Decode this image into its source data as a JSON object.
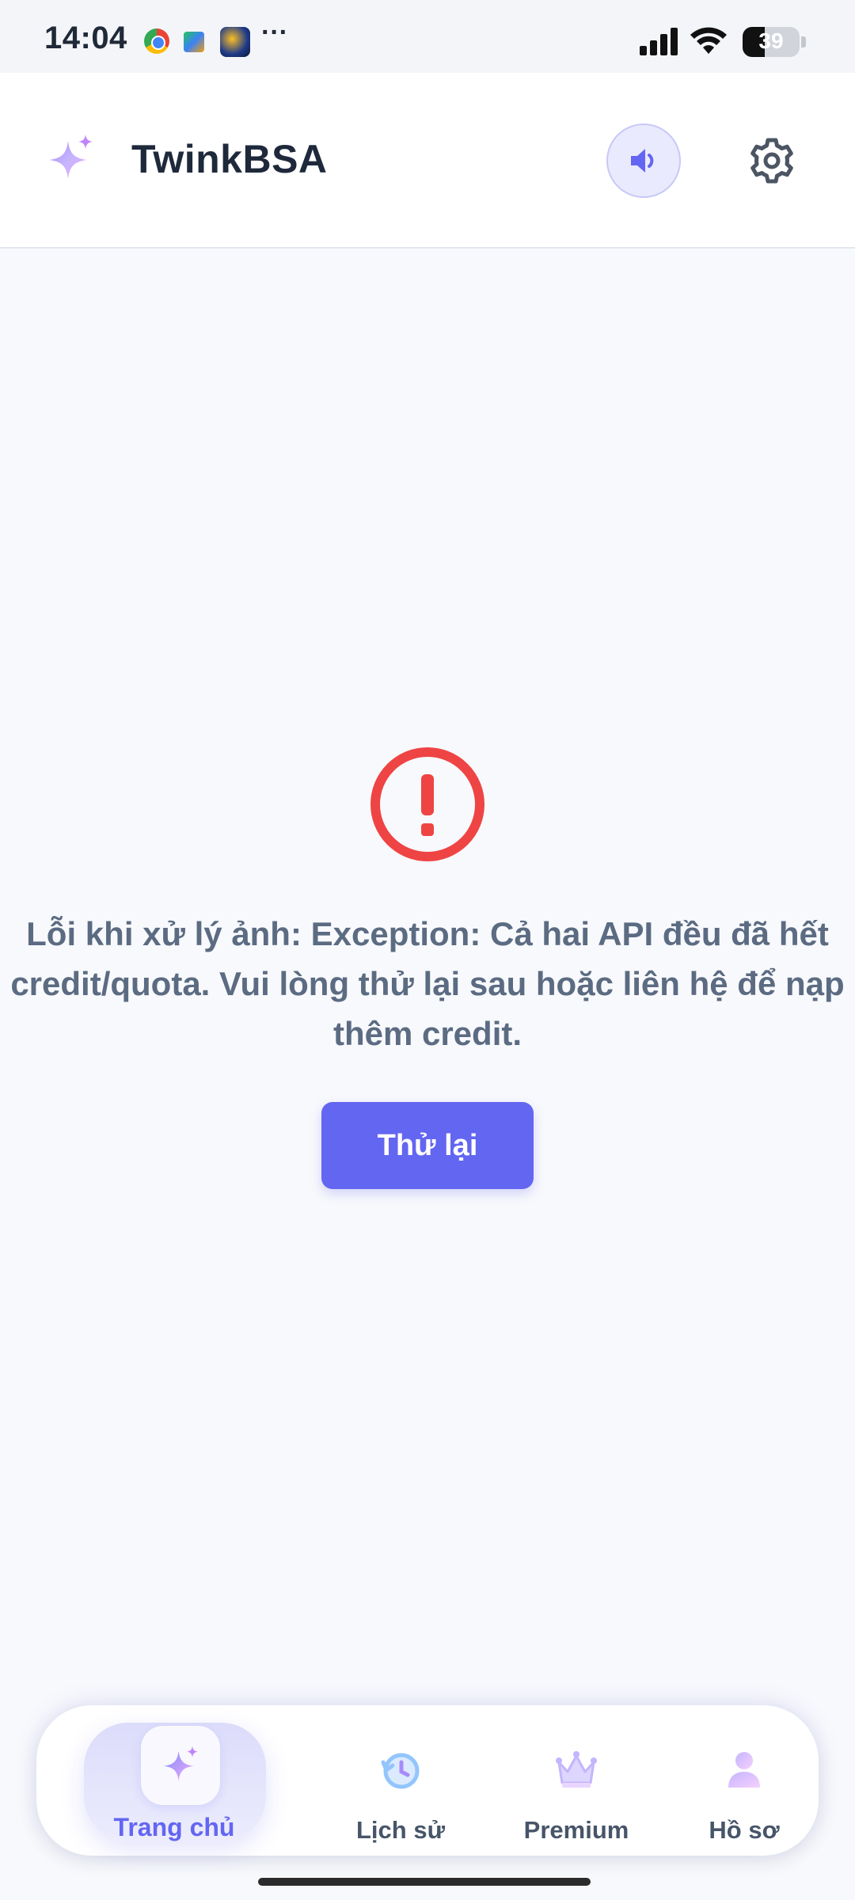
{
  "status_bar": {
    "time": "14:04",
    "more": "···",
    "battery_percent": 39,
    "battery_label": "39",
    "icons": [
      "chrome-icon",
      "puzzle-icon",
      "game-icon",
      "signal-icon",
      "wifi-icon",
      "battery-icon"
    ]
  },
  "header": {
    "title": "TwinkBSA",
    "logo_icon": "sparkle-icon",
    "sound_icon": "speaker-icon",
    "settings_icon": "gear-icon"
  },
  "error": {
    "icon": "alert-circle-icon",
    "message": "Lỗi khi xử lý ảnh: Exception: Cả hai API đều đã hết credit/quota. Vui lòng thử lại sau hoặc liên hệ để nạp thêm credit.",
    "retry_label": "Thử lại"
  },
  "bottom_nav": {
    "items": [
      {
        "label": "Trang chủ",
        "icon": "sparkle-icon",
        "active": true
      },
      {
        "label": "Lịch sử",
        "icon": "history-icon",
        "active": false
      },
      {
        "label": "Premium",
        "icon": "crown-icon",
        "active": false
      },
      {
        "label": "Hồ sơ",
        "icon": "user-icon",
        "active": false
      }
    ]
  },
  "colors": {
    "accent": "#6366f1",
    "error": "#ef4444",
    "text_muted": "#5b6b82",
    "background": "#f8f9fc"
  }
}
